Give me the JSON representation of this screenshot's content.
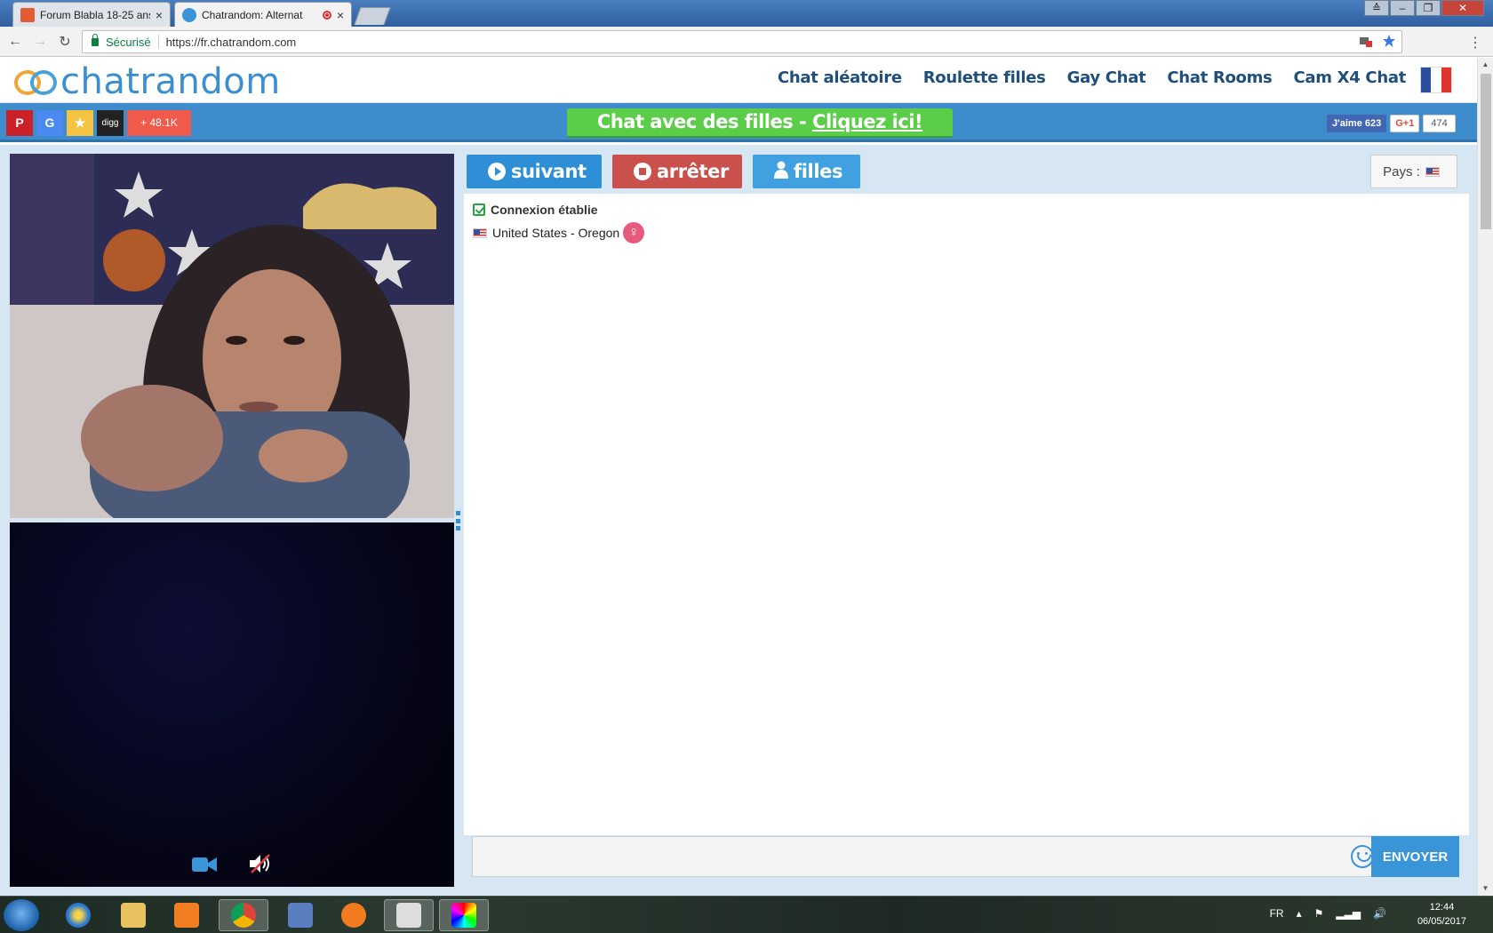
{
  "browser": {
    "tabs": [
      {
        "title": "Forum Blabla 18-25 ans",
        "close": "×"
      },
      {
        "title": "Chatrandom: Alternat",
        "close": "×"
      }
    ],
    "window_controls": [
      "≙",
      "–",
      "❐",
      "✕"
    ],
    "nav": {
      "back": "←",
      "forward": "→",
      "reload": "↻"
    },
    "address": {
      "secure_label": "Sécurisé",
      "url": "https://fr.chatrandom.com"
    },
    "menu": "⋮"
  },
  "site": {
    "logo_text": "chatrandom",
    "nav": [
      "Chat aléatoire",
      "Roulette filles",
      "Gay Chat",
      "Chat Rooms",
      "Cam X4 Chat"
    ],
    "flag_colors": [
      "#2a4fa0",
      "#ffffff",
      "#e1342c"
    ]
  },
  "banner": {
    "share_buttons": [
      {
        "label": "P",
        "color": "#cb2027"
      },
      {
        "label": "G",
        "color": "#4a8af0"
      },
      {
        "label": "★",
        "color": "#f5c342"
      },
      {
        "label": "digg",
        "color": "#222222"
      },
      {
        "label": "+ 48.1K",
        "color": "#f05a4a"
      }
    ],
    "cta_text": "Chat avec des filles - ",
    "cta_link": "Cliquez ici!",
    "fb_like": "J'aime 623",
    "gplus": "G+1",
    "gplus_count": "474"
  },
  "chat": {
    "buttons": {
      "next": "suivant",
      "stop": "arrêter",
      "girls": "filles"
    },
    "country_label": "Pays :",
    "messages": {
      "status": "Connexion établie",
      "location": "United States - Oregon",
      "gender_symbol": "♀"
    },
    "input_value": "",
    "send_label": "ENVOYER"
  },
  "taskbar": {
    "language": "FR",
    "time": "12:44",
    "date": "06/05/2017"
  },
  "colors": {
    "brand_blue": "#3e8ccb",
    "cta_green": "#5ccd49",
    "next_blue": "#2f8fd6",
    "stop_red": "#c9504b"
  }
}
